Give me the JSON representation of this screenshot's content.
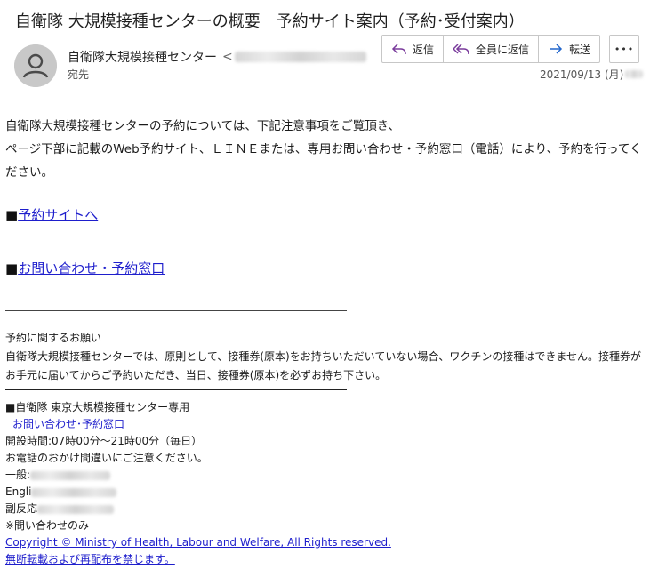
{
  "email": {
    "subject": "自衛隊 大規模接種センターの概要　予約サイト案内（予約･受付案内）",
    "sender_name": "自衛隊大規模接種センター",
    "recipient_label": "宛先",
    "date": "2021/09/13 (月)"
  },
  "toolbar": {
    "reply_label": "返信",
    "reply_all_label": "全員に返信",
    "forward_label": "転送",
    "more_label": "•••"
  },
  "icons": {
    "avatar": "person-icon",
    "reply": "reply-arrow-icon",
    "reply_all": "reply-all-arrow-icon",
    "forward": "forward-arrow-icon",
    "more": "more-dots-icon"
  },
  "body": {
    "intro_line1": "自衛隊大規模接種センターの予約については、下記注意事項をご覧頂き、",
    "intro_line2": "ページ下部に記載のWeb予約サイト、ＬＩＮＥまたは、専用お問い合わせ・予約窓口（電話）により、予約を行ってください。",
    "bullet": "■",
    "link_reservation": "予約サイトへ",
    "link_contact": "お問い合わせ・予約窓口",
    "notice_title": "予約に関するお願い",
    "notice_text": "自衛隊大規模接種センターでは、原則として、接種券(原本)をお持ちいただいていない場合、ワクチンの接種はできません。接種券がお手元に届いてからご予約いただき、当日、接種券(原本)を必ずお持ち下さい。",
    "footer_org": "■自衛隊 東京大規模接種センター専用",
    "footer_contact_link": "お問い合わせ･予約窓口",
    "footer_hours": "開設時間:07時00分～21時00分（毎日）",
    "footer_caution": "お電話のおかけ間違いにご注意ください。",
    "footer_general": "一般:",
    "footer_english": "Engli",
    "footer_side": "副反応",
    "footer_inquiry_only": "※問い合わせのみ",
    "copyright": "Copyright © Ministry of Health, Labour and Welfare, All Rights reserved.",
    "no_reprint": "無断転載および再配布を禁じます。"
  },
  "colors": {
    "link": "#1e1ecc",
    "reply_icon": "#7a3b9c",
    "forward_icon": "#2266cc"
  }
}
